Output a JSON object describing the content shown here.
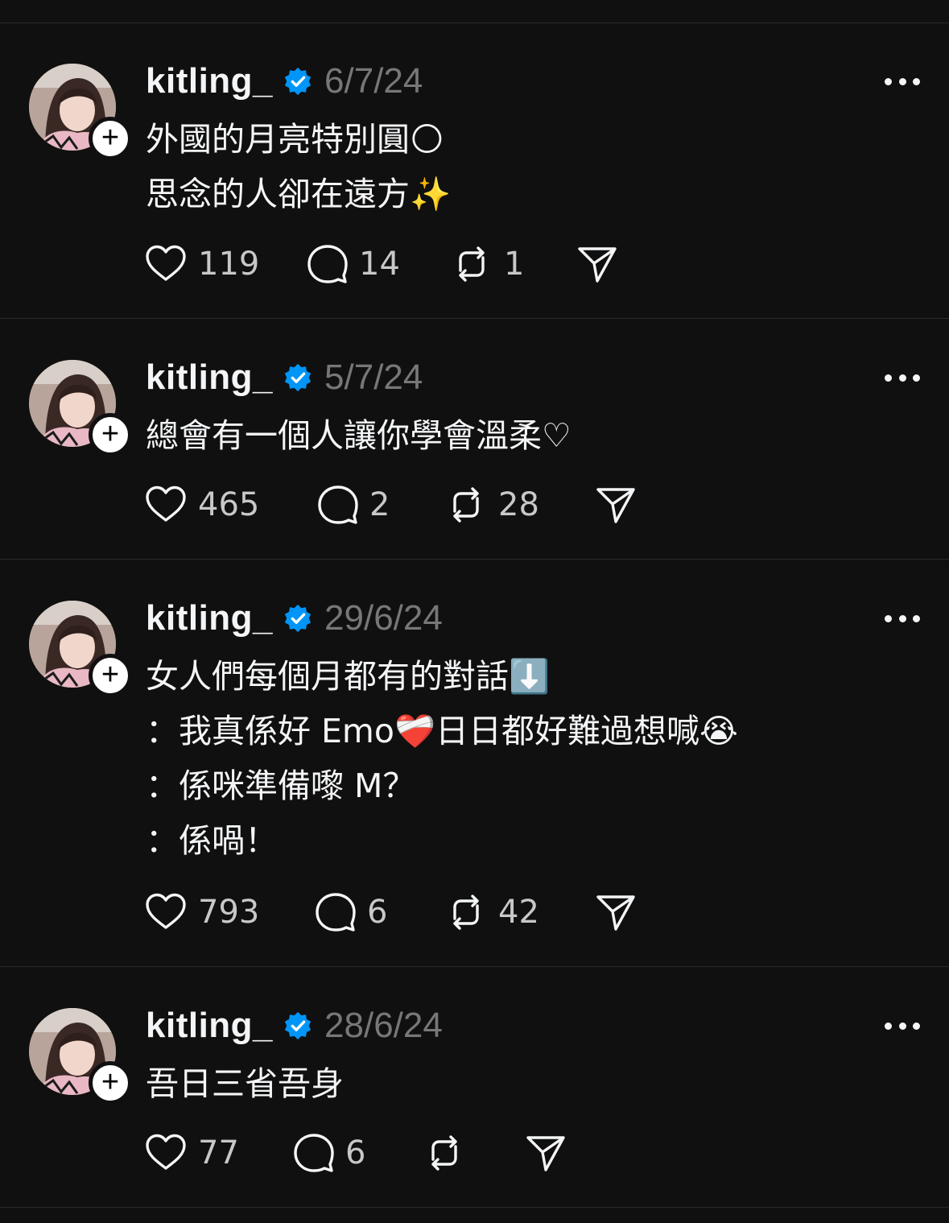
{
  "posts": [
    {
      "username": "kitling_",
      "date": "6/7/24",
      "lines": [
        "外國的月亮特別圓🌕",
        "思念的人卻在遠方✨"
      ],
      "likes": "119",
      "replies": "14",
      "reposts": "1"
    },
    {
      "username": "kitling_",
      "date": "5/7/24",
      "lines": [
        "總會有一個人讓你學會溫柔♡"
      ],
      "likes": "465",
      "replies": "2",
      "reposts": "28"
    },
    {
      "username": "kitling_",
      "date": "29/6/24",
      "lines": [
        "女人們每個月都有的對話⬇️",
        "：我真係好 Emo❤️‍🩹日日都好難過想喊😭",
        "：係咪準備嚟 M？",
        "：係喎！"
      ],
      "likes": "793",
      "replies": "6",
      "reposts": "42"
    },
    {
      "username": "kitling_",
      "date": "28/6/24",
      "lines": [
        "吾日三省吾身"
      ],
      "likes": "77",
      "replies": "6",
      "reposts": ""
    }
  ],
  "icons": {
    "avatar": "avatar-photo",
    "follow": "plus-icon",
    "verified": "verified-badge-icon",
    "more": "more-dots-icon",
    "like": "heart-icon",
    "reply": "comment-bubble-icon",
    "repost": "repost-icon",
    "share": "send-icon"
  },
  "colors": {
    "background": "#101010",
    "text": "#f3f5f7",
    "muted": "#777777",
    "verified": "#0095f6",
    "divider": "#2a2a2a"
  }
}
